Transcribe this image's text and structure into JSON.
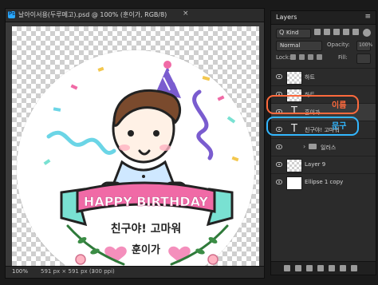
{
  "document": {
    "tab_title": "날아이서용(두루메고).psd @ 100% (훈이가, RGB/8)",
    "close_glyph": "×",
    "ps_badge": "Ps",
    "zoom": "100%",
    "doc_size": "591 px × 591 px (300 ppi)",
    "status_arrow": "›"
  },
  "artwork": {
    "banner_text": "HAPPY BIRTHDAY",
    "line1": "친구야! 고마워",
    "line2": "훈이가"
  },
  "layers_panel": {
    "tab_label": "Layers",
    "menu_glyph": "≡",
    "kind_label": "Kind",
    "kind_search_glyph": "Q",
    "blend_mode": "Normal",
    "opacity_label": "Opacity:",
    "opacity_value": "100%",
    "lock_label": "Lock:",
    "fill_label": "Fill:",
    "layers": [
      {
        "name": "하트",
        "type": "raster",
        "selected": false
      },
      {
        "name": "하트",
        "type": "raster",
        "selected": false
      },
      {
        "name": "훈이가",
        "type": "text",
        "selected": true
      },
      {
        "name": "친구야! 고마워",
        "type": "text",
        "selected": false
      },
      {
        "name": "일러스",
        "type": "group",
        "selected": false
      },
      {
        "name": "Layer 9",
        "type": "raster",
        "selected": false
      },
      {
        "name": "Ellipse 1 copy",
        "type": "raster",
        "selected": false
      }
    ]
  },
  "annotations": {
    "orange_label": "이름",
    "blue_label": "문구",
    "orange_color": "#ff6a3d",
    "blue_color": "#33b7ff"
  },
  "colors": {
    "banner_pink": "#f06aa6",
    "banner_teal": "#79e1d2",
    "accent_blue": "#2aa8ff"
  }
}
